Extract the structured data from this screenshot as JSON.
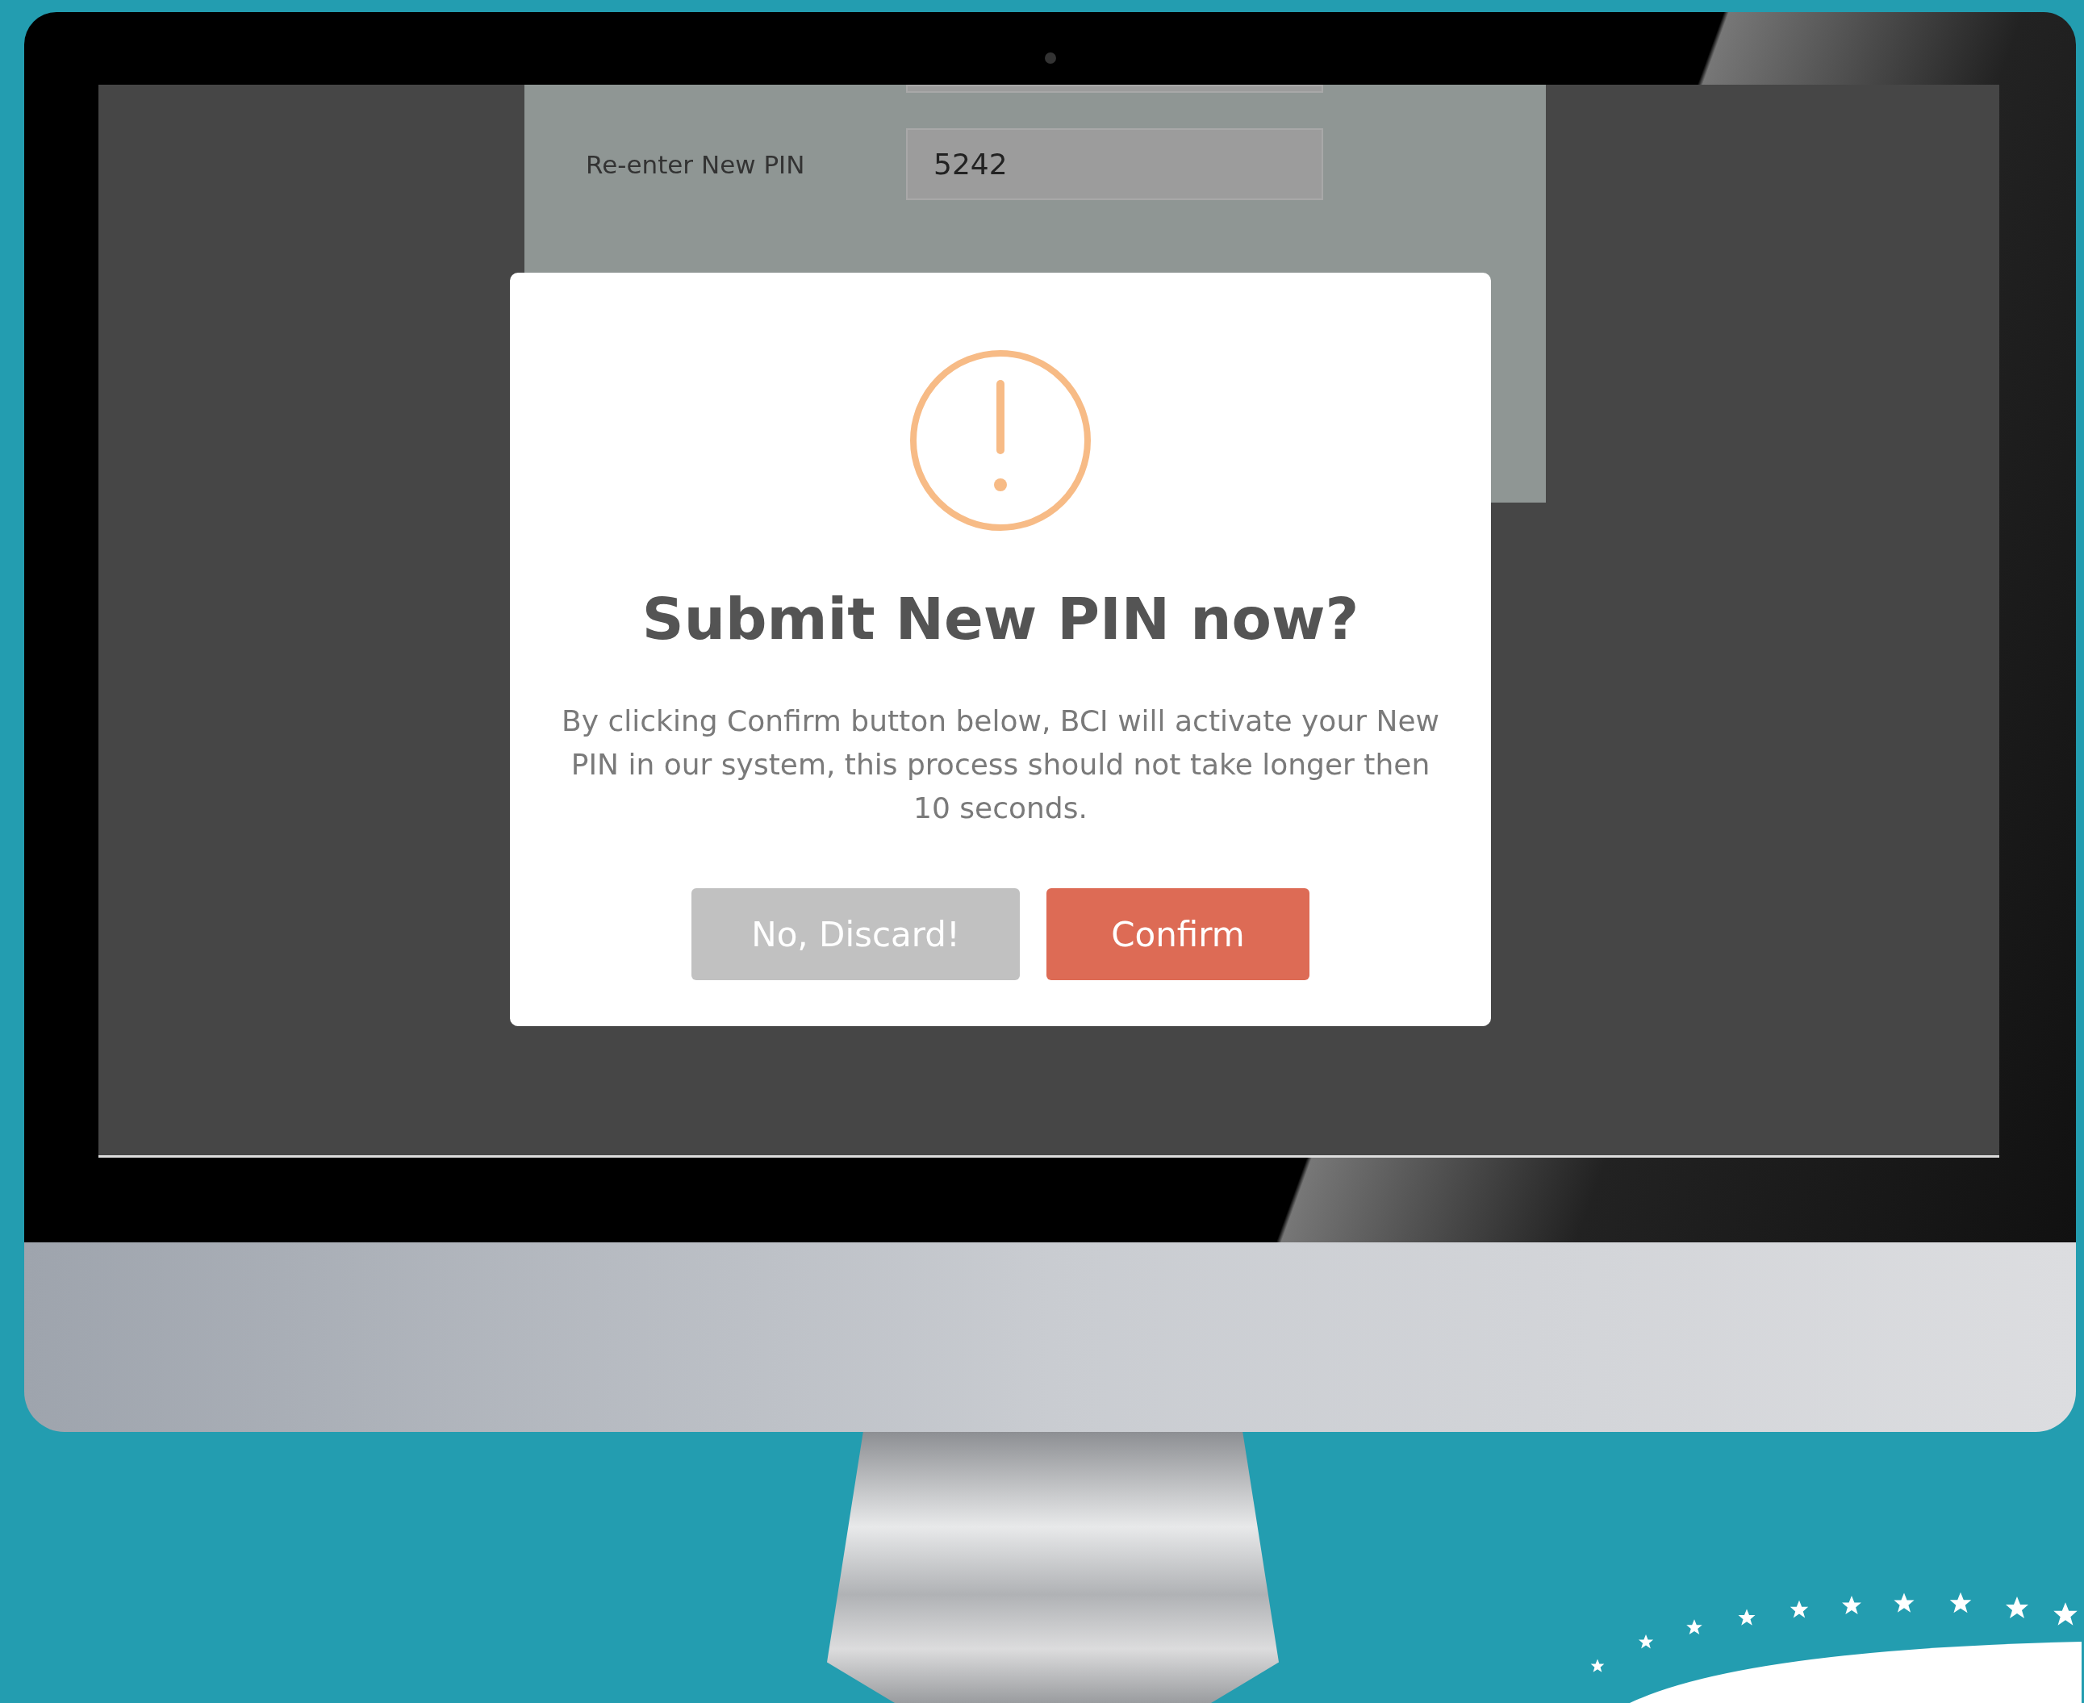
{
  "form": {
    "fields": [
      {
        "kind": "cut"
      },
      {
        "kind": "full",
        "label": "Re-enter New PIN",
        "value": "5242"
      }
    ]
  },
  "dialog": {
    "title": "Submit New PIN now?",
    "message": "By clicking Confirm button below, BCI will activate your New PIN in our system, this process should not take longer then 10 seconds.",
    "buttons": [
      {
        "label": "No, Discard!",
        "kind": "cancel"
      },
      {
        "label": "Confirm",
        "kind": "confirm"
      }
    ]
  }
}
